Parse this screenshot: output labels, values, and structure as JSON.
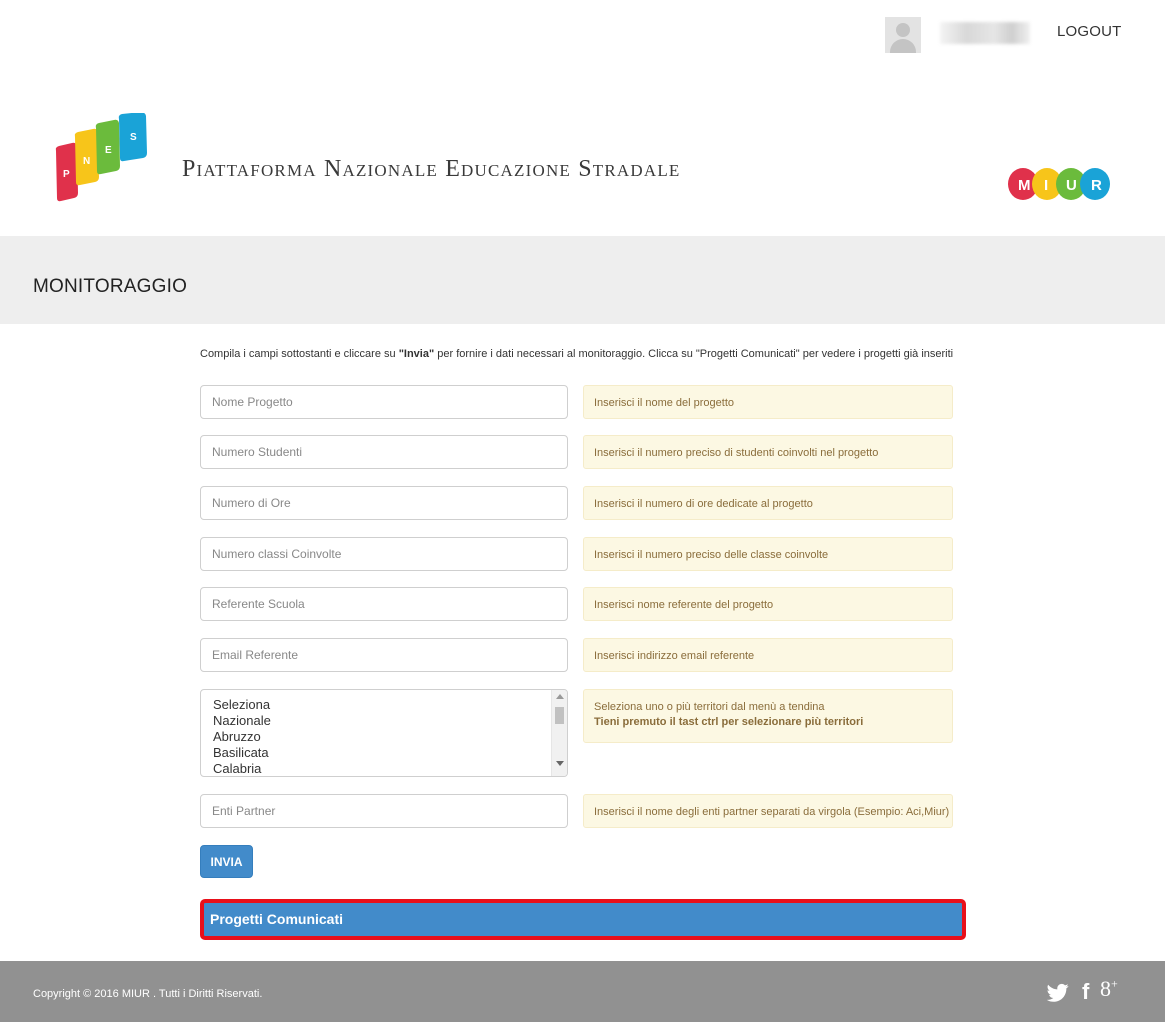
{
  "topbar": {
    "logout_label": "LOGOUT"
  },
  "header": {
    "logo_letters": [
      "P",
      "N",
      "E",
      "S"
    ],
    "site_title": "Piattaforma Nazionale Educazione Stradale",
    "miur_letters": [
      "M",
      "I",
      "U",
      "R"
    ]
  },
  "page": {
    "title": "MONITORAGGIO"
  },
  "intro": {
    "before": "Compila i campi sottostanti e cliccare su ",
    "bold": "\"Invia\"",
    "after": " per fornire i dati necessari al monitoraggio. Clicca su \"Progetti Comunicati\" per vedere i progetti già inseriti"
  },
  "form": {
    "nome_progetto": {
      "placeholder": "Nome Progetto",
      "hint": "Inserisci il nome del progetto"
    },
    "numero_studenti": {
      "placeholder": "Numero Studenti",
      "hint": "Inserisci il numero preciso di studenti coinvolti nel progetto"
    },
    "numero_ore": {
      "placeholder": "Numero di Ore",
      "hint": "Inserisci il numero di ore dedicate al progetto"
    },
    "numero_classi": {
      "placeholder": "Numero classi Coinvolte",
      "hint": "Inserisci il numero preciso delle classe coinvolte"
    },
    "referente": {
      "placeholder": "Referente Scuola",
      "hint": "Inserisci nome referente del progetto"
    },
    "email": {
      "placeholder": "Email Referente",
      "hint": "Inserisci indirizzo email referente"
    },
    "territori": {
      "options": [
        "Seleziona",
        "Nazionale",
        "Abruzzo",
        "Basilicata",
        "Calabria"
      ],
      "hint_line1": "Seleziona uno o più territori dal menù a tendina",
      "hint_line2": "Tieni premuto il tast ctrl per selezionare più territori"
    },
    "enti_partner": {
      "placeholder": "Enti Partner",
      "hint": "Inserisci il nome degli enti partner separati da virgola (Esempio: Aci,Miur)"
    }
  },
  "buttons": {
    "invia": "INVIA",
    "progetti_comunicati": "Progetti Comunicati"
  },
  "footer": {
    "copyright": "Copyright © 2016 MIUR . Tutti i Diritti Riservati.",
    "facebook_glyph": "f",
    "gplus_glyph": "8",
    "gplus_sup": "+"
  },
  "colors": {
    "primary": "#428bca",
    "highlight_border": "#e8101a",
    "hint_bg": "#fcf8e3",
    "hint_text": "#8a6d3b",
    "footer_bg": "#919191",
    "band_bg": "#eeeeee"
  },
  "icons": [
    "user-avatar-icon",
    "twitter-icon",
    "facebook-icon",
    "google-plus-icon"
  ]
}
